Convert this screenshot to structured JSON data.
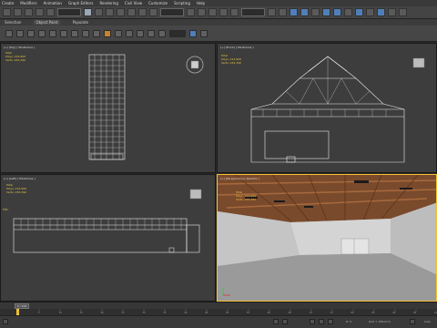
{
  "menu": [
    "Create",
    "Modifiers",
    "Animation",
    "Graph Editors",
    "Rendering",
    "Civil View",
    "Customize",
    "Scripting",
    "Help"
  ],
  "ribbon_tabs": [
    "Selection",
    "Object Paint",
    "Populate"
  ],
  "viewports": {
    "top": {
      "label": "[+] [Top] [ Wireframe ]",
      "stats": {
        "total": "Total",
        "polys": "Polys:  215,609",
        "verts": "Verts:  232,390"
      }
    },
    "front": {
      "label": "[+] [Front] [ Wireframe ]",
      "stats": {
        "total": "Total",
        "polys": "Polys:  215,609",
        "verts": "Verts:  232,390"
      }
    },
    "left": {
      "label": "[+] [Left] [ Wireframe ]",
      "stats": {
        "total": "Total",
        "polys": "Polys:  215,609",
        "verts": "Verts:  232,390"
      }
    },
    "perspective": {
      "label": "[+] [Perspective] [ Realistic ]",
      "stats": {
        "total": "Total",
        "polys": "Polys:  215,609",
        "verts": "Verts:  232,390"
      }
    }
  },
  "fps_label": "FPS:",
  "time_slider": "0 / 100",
  "timeline_ticks": [
    "0",
    "5",
    "10",
    "15",
    "20",
    "25",
    "30",
    "35",
    "40",
    "45",
    "50",
    "55",
    "60",
    "65",
    "70",
    "75",
    "80",
    "85",
    "90",
    "95",
    "100"
  ],
  "coords": {
    "z": "Z: 0",
    "grid": "Grid = 254,0cm"
  },
  "auto_label": "Auto",
  "colors": {
    "active_border": "#f2c230",
    "stats_text": "#e5c440",
    "background": "#3d3d3d"
  }
}
